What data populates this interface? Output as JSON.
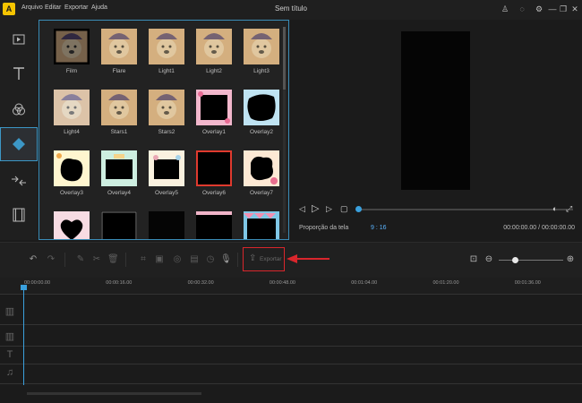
{
  "app": {
    "logo_glyph": "A",
    "title": "Sem título",
    "accent": "#3aa0dd"
  },
  "menu": {
    "items": [
      "Arquivo",
      "Editar",
      "Exportar",
      "Ajuda"
    ]
  },
  "window_controls": {
    "user": "♙",
    "chat": "◌",
    "settings": "⚙",
    "minimize": "—",
    "maximize": "❐",
    "close": "✕"
  },
  "sidebar": {
    "items": [
      {
        "name": "media-icon",
        "glyph": "▶"
      },
      {
        "name": "text-icon",
        "glyph": "T"
      },
      {
        "name": "filters-icon",
        "glyph": "☘"
      },
      {
        "name": "overlays-icon",
        "glyph": "◆"
      },
      {
        "name": "transitions-icon",
        "glyph": "⇆"
      },
      {
        "name": "elements-icon",
        "glyph": "▦"
      }
    ]
  },
  "library": {
    "items": [
      {
        "label": "Film",
        "style": "film"
      },
      {
        "label": "Flare",
        "style": "photo"
      },
      {
        "label": "Light1",
        "style": "photo"
      },
      {
        "label": "Light2",
        "style": "photo"
      },
      {
        "label": "Light3",
        "style": "photo"
      },
      {
        "label": "Light4",
        "style": "photo-light"
      },
      {
        "label": "Stars1",
        "style": "photo"
      },
      {
        "label": "Stars2",
        "style": "photo"
      },
      {
        "label": "Overlay1",
        "style": "frame-pink"
      },
      {
        "label": "Overlay2",
        "style": "frame-blob"
      },
      {
        "label": "Overlay3",
        "style": "frame-yellow"
      },
      {
        "label": "Overlay4",
        "style": "frame-mint"
      },
      {
        "label": "Overlay5",
        "style": "frame-cream"
      },
      {
        "label": "Overlay6",
        "style": "frame-red"
      },
      {
        "label": "Overlay7",
        "style": "frame-flower"
      },
      {
        "label": "",
        "style": "frame-heart"
      },
      {
        "label": "",
        "style": "frame-dark"
      },
      {
        "label": "",
        "style": "frame-dark2"
      },
      {
        "label": "",
        "style": "frame-lace"
      },
      {
        "label": "",
        "style": "frame-bunting"
      }
    ]
  },
  "preview": {
    "ratio_label": "Proporção da tela",
    "ratio_value": "9 : 16",
    "timecode": "00:00:00.00 / 00:00:00.00",
    "progress": 0
  },
  "toolbar": {
    "export_label": "Exportar",
    "zoom_level": 0.22
  },
  "timeline": {
    "ticks": [
      "00:00:00.00",
      "00:00:16.00",
      "00:00:32.00",
      "00:00:48.00",
      "00:01:04.00",
      "00:01:20.00",
      "00:01:36.00"
    ]
  }
}
